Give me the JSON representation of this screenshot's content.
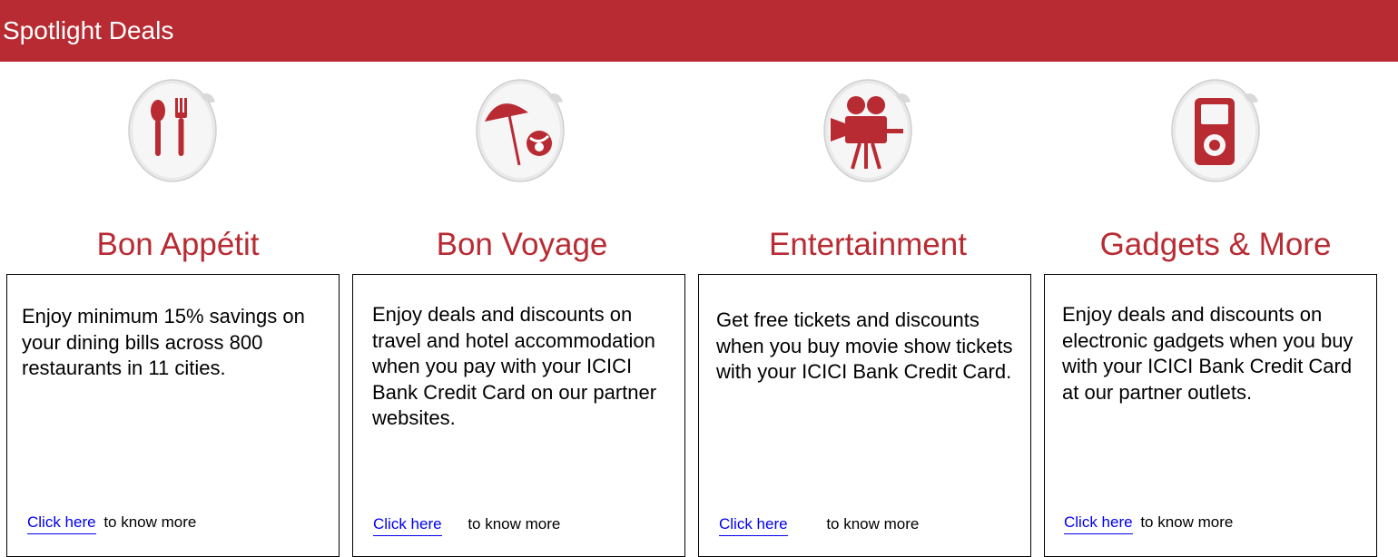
{
  "header": {
    "title": "Spotlight Deals"
  },
  "colors": {
    "brand": "#b82b33",
    "link": "#0000ee",
    "text": "#000000"
  },
  "deals": [
    {
      "icon": "dining-icon",
      "title": "Bon Appétit",
      "description": "Enjoy minimum 15% savings on your dining bills across 800 restaurants in 11 cities.",
      "link_label": "Click here",
      "link_suffix": "to know more"
    },
    {
      "icon": "travel-icon",
      "title": "Bon Voyage",
      "description": "Enjoy deals and discounts on travel and hotel accommodation when you pay with your ICICI Bank Credit Card on our partner websites.",
      "link_label": "Click here",
      "link_suffix": "to know more"
    },
    {
      "icon": "movie-camera-icon",
      "title": "Entertainment",
      "description": "Get free tickets and discounts when you buy movie show tickets with your ICICI Bank Credit Card.",
      "link_label": "Click here",
      "link_suffix": "to know more"
    },
    {
      "icon": "music-player-icon",
      "title": "Gadgets & More",
      "description": "Enjoy deals and discounts on electronic gadgets when you buy with your ICICI Bank Credit Card at our partner outlets.",
      "link_label": "Click here",
      "link_suffix": "to know more"
    }
  ]
}
